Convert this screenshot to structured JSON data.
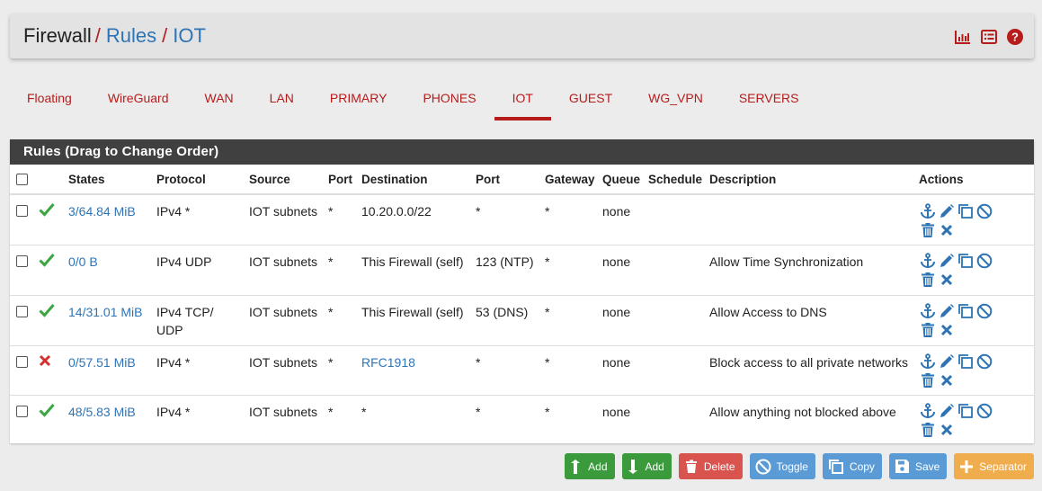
{
  "breadcrumb": {
    "root": "Firewall",
    "sep": "/",
    "level2": "Rules",
    "level3": "IOT"
  },
  "tabs": [
    {
      "label": "Floating"
    },
    {
      "label": "WireGuard"
    },
    {
      "label": "WAN"
    },
    {
      "label": "LAN"
    },
    {
      "label": "PRIMARY"
    },
    {
      "label": "PHONES"
    },
    {
      "label": "IOT",
      "active": true
    },
    {
      "label": "GUEST"
    },
    {
      "label": "WG_VPN"
    },
    {
      "label": "SERVERS"
    }
  ],
  "panel": {
    "title": "Rules (Drag to Change Order)"
  },
  "columns": [
    "States",
    "Protocol",
    "Source",
    "Port",
    "Destination",
    "Port",
    "Gateway",
    "Queue",
    "Schedule",
    "Description",
    "Actions"
  ],
  "rows": [
    {
      "status": "pass",
      "states": "3/64.84 MiB",
      "protocol": "IPv4 *",
      "source": "IOT subnets",
      "sport": "*",
      "destination": "10.20.0.0/22",
      "dest_link": false,
      "dport": "*",
      "gateway": "*",
      "queue": "none",
      "schedule": "",
      "description": ""
    },
    {
      "status": "pass",
      "states": "0/0 B",
      "protocol": "IPv4 UDP",
      "source": "IOT subnets",
      "sport": "*",
      "destination": "This Firewall (self)",
      "dest_link": false,
      "dport": "123 (NTP)",
      "gateway": "*",
      "queue": "none",
      "schedule": "",
      "description": "Allow Time Synchronization"
    },
    {
      "status": "pass",
      "states": "14/31.01 MiB",
      "protocol": "IPv4 TCP/ UDP",
      "source": "IOT subnets",
      "sport": "*",
      "destination": "This Firewall (self)",
      "dest_link": false,
      "dport": "53 (DNS)",
      "gateway": "*",
      "queue": "none",
      "schedule": "",
      "description": "Allow Access to DNS"
    },
    {
      "status": "block",
      "states": "0/57.51 MiB",
      "protocol": "IPv4 *",
      "source": "IOT subnets",
      "sport": "*",
      "destination": "RFC1918",
      "dest_link": true,
      "dport": "*",
      "gateway": "*",
      "queue": "none",
      "schedule": "",
      "description": "Block access to all private networks"
    },
    {
      "status": "pass",
      "states": "48/5.83 MiB",
      "protocol": "IPv4 *",
      "source": "IOT subnets",
      "sport": "*",
      "destination": "*",
      "dest_link": false,
      "dport": "*",
      "gateway": "*",
      "queue": "none",
      "schedule": "",
      "description": "Allow anything not blocked above"
    }
  ],
  "buttons": {
    "add_top": "Add",
    "add_bottom": "Add",
    "delete": "Delete",
    "toggle": "Toggle",
    "copy": "Copy",
    "save": "Save",
    "separator": "Separator"
  },
  "colors": {
    "accent_red": "#b71c1c",
    "link_blue": "#2e74b5",
    "pass_green": "#3aa641",
    "block_red": "#d32f2f"
  }
}
